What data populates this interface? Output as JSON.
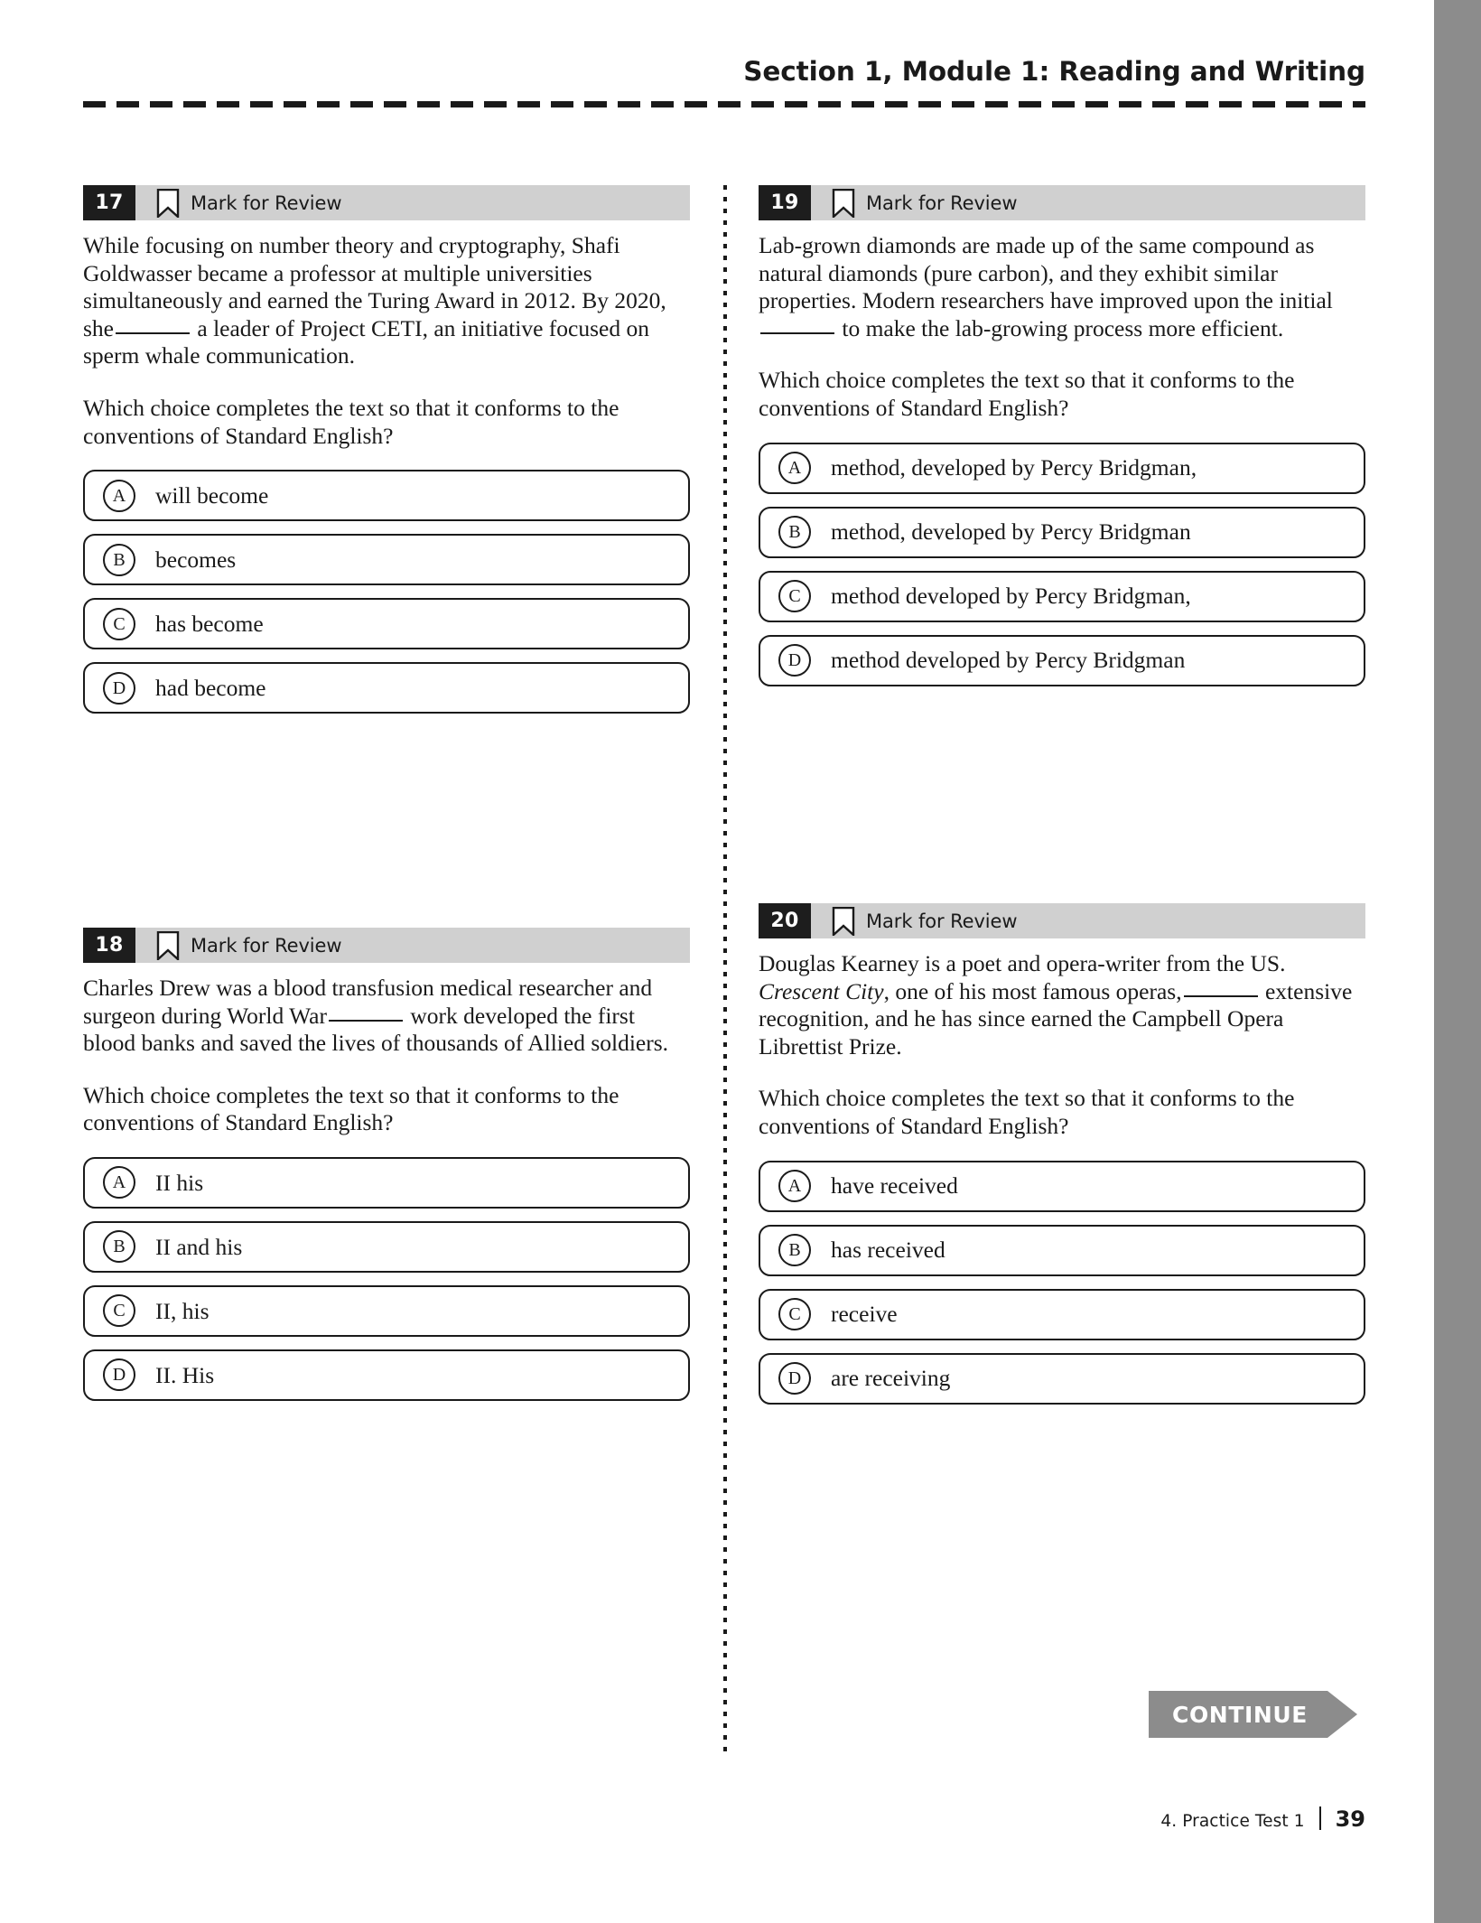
{
  "header": {
    "title": "Section 1, Module 1: Reading and Writing"
  },
  "mark_for_review_label": "Mark for Review",
  "common_prompt": "Which choice completes the text so that it conforms to the conventions of Standard English?",
  "questions": [
    {
      "number": "17",
      "passage_part1": "While focusing on number theory and cryptography, Shafi Goldwasser became a professor at multiple universities simultaneously and earned the Turing Award in 2012. By 2020, she",
      "passage_part2": "a leader of Project CETI, an initiative focused on sperm whale communication.",
      "prompt": "Which choice completes the text so that it conforms to the conventions of Standard English?",
      "choices": [
        {
          "letter": "A",
          "text": "will become"
        },
        {
          "letter": "B",
          "text": "becomes"
        },
        {
          "letter": "C",
          "text": "has become"
        },
        {
          "letter": "D",
          "text": "had become"
        }
      ]
    },
    {
      "number": "18",
      "passage_part1": "Charles Drew was a blood transfusion medical researcher and surgeon during World War",
      "passage_part2": "work developed the first blood banks and saved the lives of thousands of Allied soldiers.",
      "prompt": "Which choice completes the text so that it conforms to the conventions of Standard English?",
      "choices": [
        {
          "letter": "A",
          "text": "II his"
        },
        {
          "letter": "B",
          "text": "II and his"
        },
        {
          "letter": "C",
          "text": "II, his"
        },
        {
          "letter": "D",
          "text": "II. His"
        }
      ]
    },
    {
      "number": "19",
      "passage_part1": "Lab-grown diamonds are made up of the same compound as natural diamonds (pure carbon), and they exhibit similar properties. Modern researchers have improved upon the initial",
      "passage_part2": "to make the lab-growing process more efficient.",
      "prompt": "Which choice completes the text so that it conforms to the conventions of Standard English?",
      "choices": [
        {
          "letter": "A",
          "text": "method, developed by Percy Bridgman,"
        },
        {
          "letter": "B",
          "text": "method, developed by Percy Bridgman"
        },
        {
          "letter": "C",
          "text": "method developed by Percy Bridgman,"
        },
        {
          "letter": "D",
          "text": "method developed by Percy Bridgman"
        }
      ]
    },
    {
      "number": "20",
      "passage_part1": "Douglas Kearney is a poet and opera-writer from the US.",
      "passage_italic": "Crescent City",
      "passage_part1b": ", one of his most famous operas,",
      "passage_part2": "extensive recognition, and he has since earned the Campbell Opera Librettist Prize.",
      "prompt": "Which choice completes the text so that it conforms to the conventions of Standard English?",
      "choices": [
        {
          "letter": "A",
          "text": "have received"
        },
        {
          "letter": "B",
          "text": "has received"
        },
        {
          "letter": "C",
          "text": "receive"
        },
        {
          "letter": "D",
          "text": "are receiving"
        }
      ]
    }
  ],
  "continue_button": {
    "label": "CONTINUE"
  },
  "footer": {
    "label": "4.  Practice Test 1",
    "page_number": "39"
  },
  "colors": {
    "header_bar": "#d0d0d0",
    "number_box": "#1d1d1d",
    "continue": "#8c8c8c",
    "edge_bar": "#8c8c8c"
  }
}
